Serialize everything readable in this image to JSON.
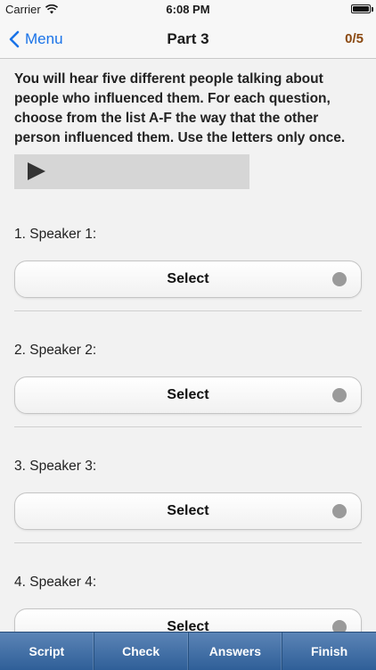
{
  "status_bar": {
    "carrier": "Carrier",
    "time": "6:08 PM"
  },
  "nav": {
    "back_label": "Menu",
    "title": "Part 3",
    "score": "0/5"
  },
  "instructions": "You will hear five different people talking about people who influenced them. For each question, choose from the list A-F the way that the other person influenced them. Use the letters only once.",
  "questions": [
    {
      "label": "1. Speaker 1:",
      "select_label": "Select"
    },
    {
      "label": "2. Speaker 2:",
      "select_label": "Select"
    },
    {
      "label": "3. Speaker 3:",
      "select_label": "Select"
    },
    {
      "label": "4. Speaker 4:",
      "select_label": "Select"
    }
  ],
  "toolbar": {
    "script": "Script",
    "check": "Check",
    "answers": "Answers",
    "finish": "Finish"
  },
  "colors": {
    "accent": "#1a73e8",
    "score": "#8b4a12",
    "toolbar": "#3f6ea6"
  }
}
